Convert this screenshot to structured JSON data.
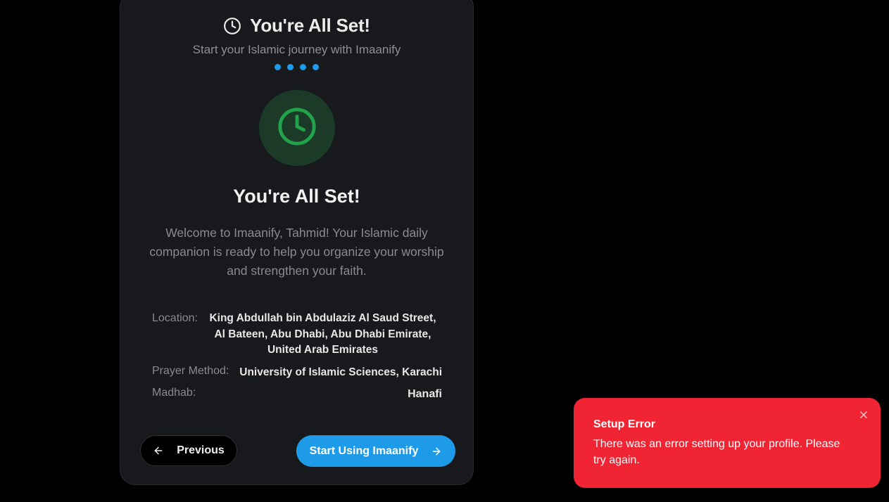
{
  "header": {
    "title": "You're All Set!",
    "subtitle": "Start your Islamic journey with Imaanify",
    "icon": "clock-icon"
  },
  "progress": {
    "steps_total": 4,
    "steps_completed": 4,
    "accent_color": "#1e9be8"
  },
  "hero": {
    "icon": "clock-icon",
    "icon_color": "#22a24a",
    "background_color": "#1b3a28"
  },
  "main": {
    "title": "You're All Set!",
    "welcome_text": "Welcome to Imaanify, Tahmid! Your Islamic daily companion is ready to help you organize your worship and strengthen your faith."
  },
  "details": {
    "location_label": "Location:",
    "location_value": "King Abdullah bin Abdulaziz Al Saud Street, Al Bateen, Abu Dhabi, Abu Dhabi Emirate, United Arab Emirates",
    "prayer_method_label": "Prayer Method:",
    "prayer_method_value": "University of Islamic Sciences, Karachi",
    "madhab_label": "Madhab:",
    "madhab_value": "Hanafi"
  },
  "buttons": {
    "previous_label": "Previous",
    "previous_icon": "arrow-left-icon",
    "start_label": "Start Using Imaanify",
    "start_icon": "arrow-right-icon",
    "start_color": "#1e9be8"
  },
  "toast": {
    "title": "Setup Error",
    "message": "There was an error setting up your profile. Please try again.",
    "close_icon": "close-icon",
    "background_color": "#f12433"
  }
}
